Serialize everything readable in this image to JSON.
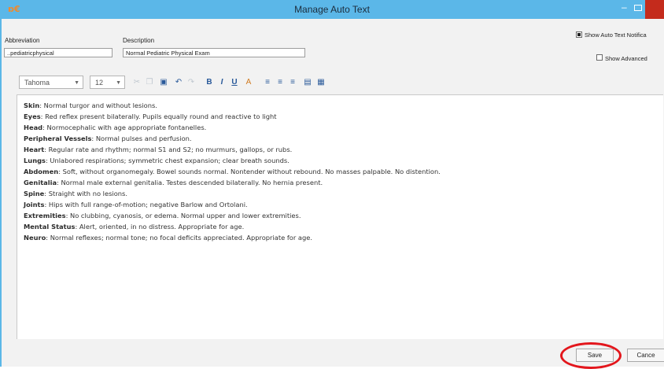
{
  "window": {
    "title": "Manage Auto Text",
    "app_icon": "app-logo-icon"
  },
  "form": {
    "abbreviation_label": "Abbreviation",
    "abbreviation_value": "..pediatricphysical",
    "description_label": "Description",
    "description_value": "Normal Pediatric Physical Exam",
    "show_notification_label": "Show Auto Text Notifica",
    "show_notification_checked": true,
    "show_advanced_label": "Show Advanced",
    "show_advanced_checked": false
  },
  "toolbar": {
    "font_name": "Tahoma",
    "font_size": "12",
    "icons": [
      "cut-icon",
      "copy-icon",
      "paste-icon",
      "undo-icon",
      "redo-icon",
      "bold-icon",
      "italic-icon",
      "underline-icon",
      "font-color-icon",
      "align-left-icon",
      "align-center-icon",
      "align-right-icon",
      "insert-image-icon",
      "table-icon"
    ],
    "bold_label": "B",
    "italic_label": "I",
    "underline_label": "U"
  },
  "content": [
    {
      "heading": "Skin",
      "text": ": Normal turgor and without lesions."
    },
    {
      "heading": "Eyes",
      "text": ": Red reflex present bilaterally. Pupils equally round and reactive to light"
    },
    {
      "heading": "Head",
      "text": ": Normocephalic with age appropriate fontanelles."
    },
    {
      "heading": "Peripheral Vessels",
      "text": ": Normal pulses and perfusion."
    },
    {
      "heading": "Heart",
      "text": ": Regular rate and rhythm; normal S1 and S2; no murmurs, gallops, or rubs."
    },
    {
      "heading": "Lungs",
      "text": ": Unlabored respirations; symmetric chest expansion; clear breath sounds."
    },
    {
      "heading": "Abdomen",
      "text": ": Soft, without organomegaly. Bowel sounds normal. Nontender without rebound. No masses palpable. No distention."
    },
    {
      "heading": "Genitalia",
      "text": ": Normal male external genitalia. Testes descended bilaterally. No hernia present."
    },
    {
      "heading": "Spine",
      "text": ": Straight with no lesions."
    },
    {
      "heading": "Joints",
      "text": ": Hips with full range-of-motion; negative Barlow and Ortolani."
    },
    {
      "heading": "Extremities",
      "text": ": No clubbing, cyanosis, or edema. Normal upper and lower extremities."
    },
    {
      "heading": "Mental Status",
      "text": ": Alert, oriented, in no distress. Appropriate for age."
    },
    {
      "heading": "Neuro",
      "text": ": Normal reflexes; normal tone; no focal deficits appreciated. Appropriate for age."
    }
  ],
  "buttons": {
    "save_label": "Save",
    "cancel_label": "Cance"
  },
  "colors": {
    "titlebar": "#5bb7e8",
    "close_button": "#c42b1c",
    "highlight_circle": "#e3161c"
  }
}
